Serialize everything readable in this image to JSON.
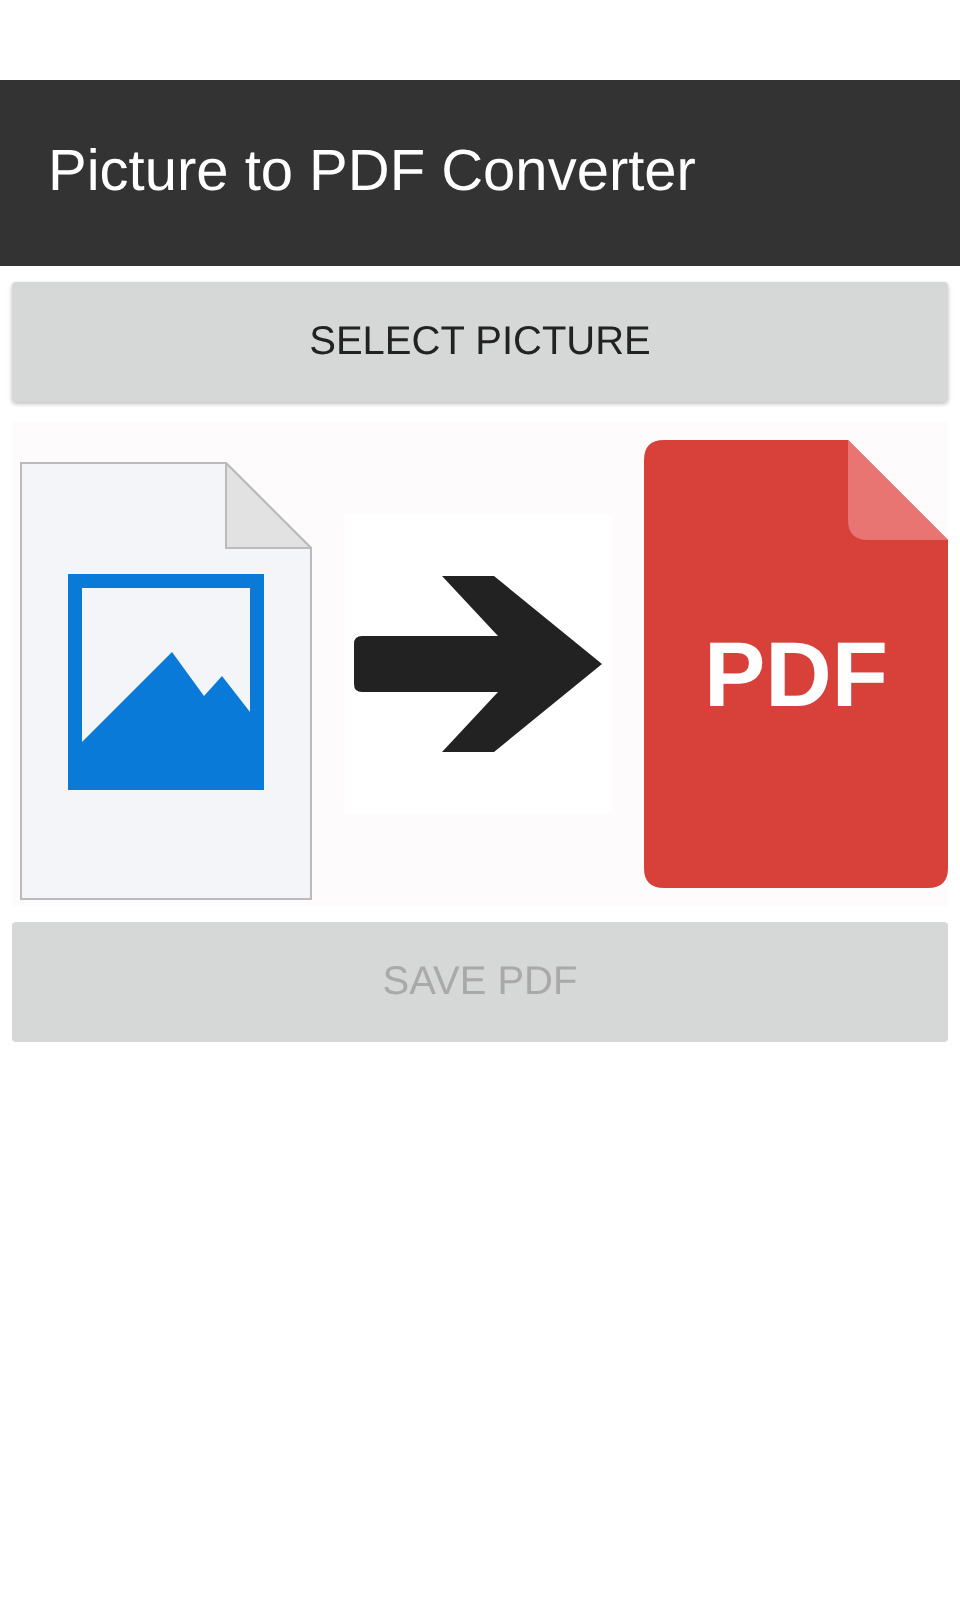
{
  "app_bar": {
    "title": "Picture to PDF Converter"
  },
  "buttons": [
    {
      "label": "SELECT PICTURE",
      "disabled": false
    },
    {
      "label": "SAVE PDF",
      "disabled": true
    }
  ],
  "illustration": {
    "pdf_label": "PDF"
  }
}
